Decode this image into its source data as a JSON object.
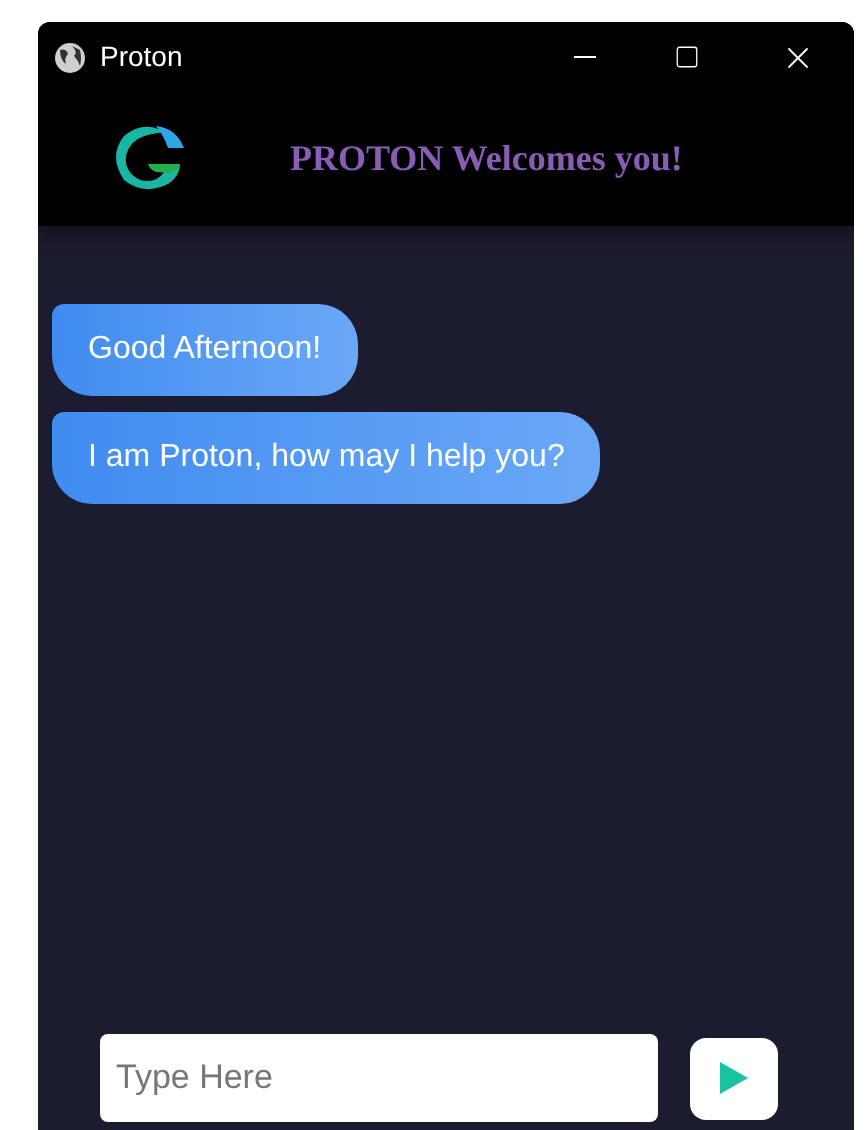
{
  "window": {
    "title": "Proton"
  },
  "header": {
    "title": "PROTON Welcomes you!"
  },
  "messages": [
    {
      "text": "Good Afternoon!"
    },
    {
      "text": "I am Proton, how may I help you?"
    }
  ],
  "input": {
    "placeholder": "Type Here"
  }
}
